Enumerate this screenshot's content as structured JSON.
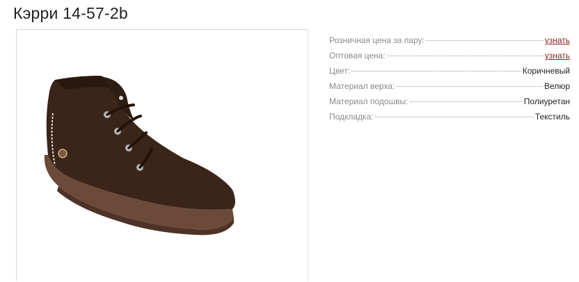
{
  "product": {
    "title": "Кэрри 14-57-2b",
    "image_alt": "brown suede lace-up ankle boot"
  },
  "specs": {
    "retail_price": {
      "label": "Розничная цена за пару:",
      "value": "узнать"
    },
    "wholesale_price": {
      "label": "Оптовая цена:",
      "value": "узнать"
    },
    "color": {
      "label": "Цвет:",
      "value": "Коричневый"
    },
    "upper_material": {
      "label": "Материал верха:",
      "value": "Велюр"
    },
    "sole_material": {
      "label": "Материал подошвы:",
      "value": "Полиуретан"
    },
    "lining": {
      "label": "Подкладка:",
      "value": "Текстиль"
    }
  },
  "colors": {
    "link": "#8b1e1e",
    "label": "#8a8a8a",
    "boot_suede": "#3b2418",
    "boot_sole": "#6b4a3a"
  }
}
